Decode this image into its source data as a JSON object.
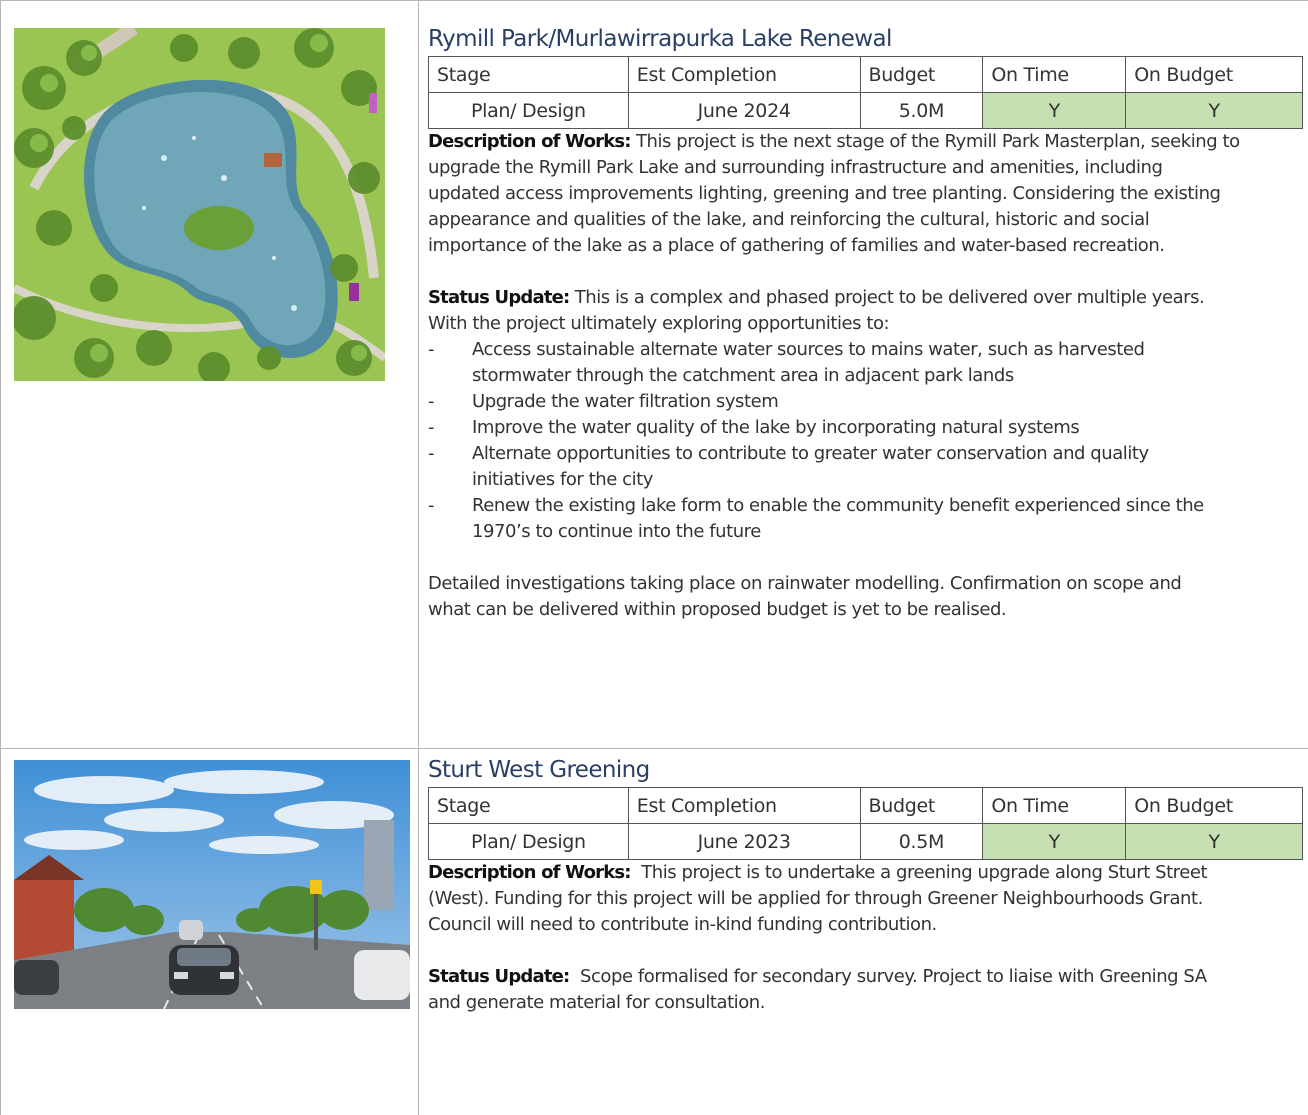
{
  "table_headers": [
    "Stage",
    "Est Completion",
    "Budget",
    "On Time",
    "On Budget"
  ],
  "projects": [
    {
      "title": "Rymill Park/Murlawirrapurka Lake Renewal",
      "stage": "Plan/ Design",
      "completion": "June 2024",
      "budget": "5.0M",
      "on_time": "Y",
      "on_budget": "Y",
      "description_label": "Description of Works:",
      "description_lines": [
        " This project is the next stage of the Rymill Park Masterplan, seeking to",
        "upgrade the Rymill Park Lake and surrounding infrastructure and amenities, including",
        "updated access improvements lighting, greening and tree planting.  Considering the existing",
        "appearance and qualities of the lake, and reinforcing the cultural, historic and social",
        "importance of the lake as a place of gathering of families and water-based recreation."
      ],
      "status_label": "Status Update:",
      "status_lines": [
        " This is a complex and phased project to be delivered over multiple years.",
        "With the project ultimately exploring opportunities to:"
      ],
      "bullets": [
        [
          "Access sustainable alternate water sources to mains water, such as harvested",
          "stormwater through the catchment area in adjacent park lands"
        ],
        [
          "Upgrade the water filtration system"
        ],
        [
          "Improve the water quality of the lake by incorporating natural systems"
        ],
        [
          "Alternate opportunities to contribute to greater water conservation and quality",
          "initiatives for the city"
        ],
        [
          "Renew the existing lake form to enable the community benefit experienced since the",
          "1970’s to continue into the future"
        ]
      ],
      "closing_lines": [
        "Detailed investigations taking place on rainwater modelling. Confirmation on scope and",
        "what can be delivered within proposed budget is yet to be realised."
      ]
    },
    {
      "title": "Sturt West Greening",
      "stage": "Plan/ Design",
      "completion": "June 2023",
      "budget": "0.5M",
      "on_time": "Y",
      "on_budget": "Y",
      "description_label": "Description of Works:",
      "description_lines": [
        "  This project is to undertake a greening upgrade along Sturt Street",
        "(West). Funding for this project will be applied for through Greener Neighbourhoods Grant.",
        "Council will need to contribute in-kind funding contribution."
      ],
      "status_label": "Status Update:",
      "status_lines": [
        "  Scope formalised for secondary survey. Project to liaise with Greening SA",
        "and generate material for consultation."
      ]
    }
  ],
  "bullet_marker": "-",
  "colors": {
    "title": "#2a3f66",
    "ok_cell": "#c6e0b4",
    "grid": "#b5b5b5"
  }
}
